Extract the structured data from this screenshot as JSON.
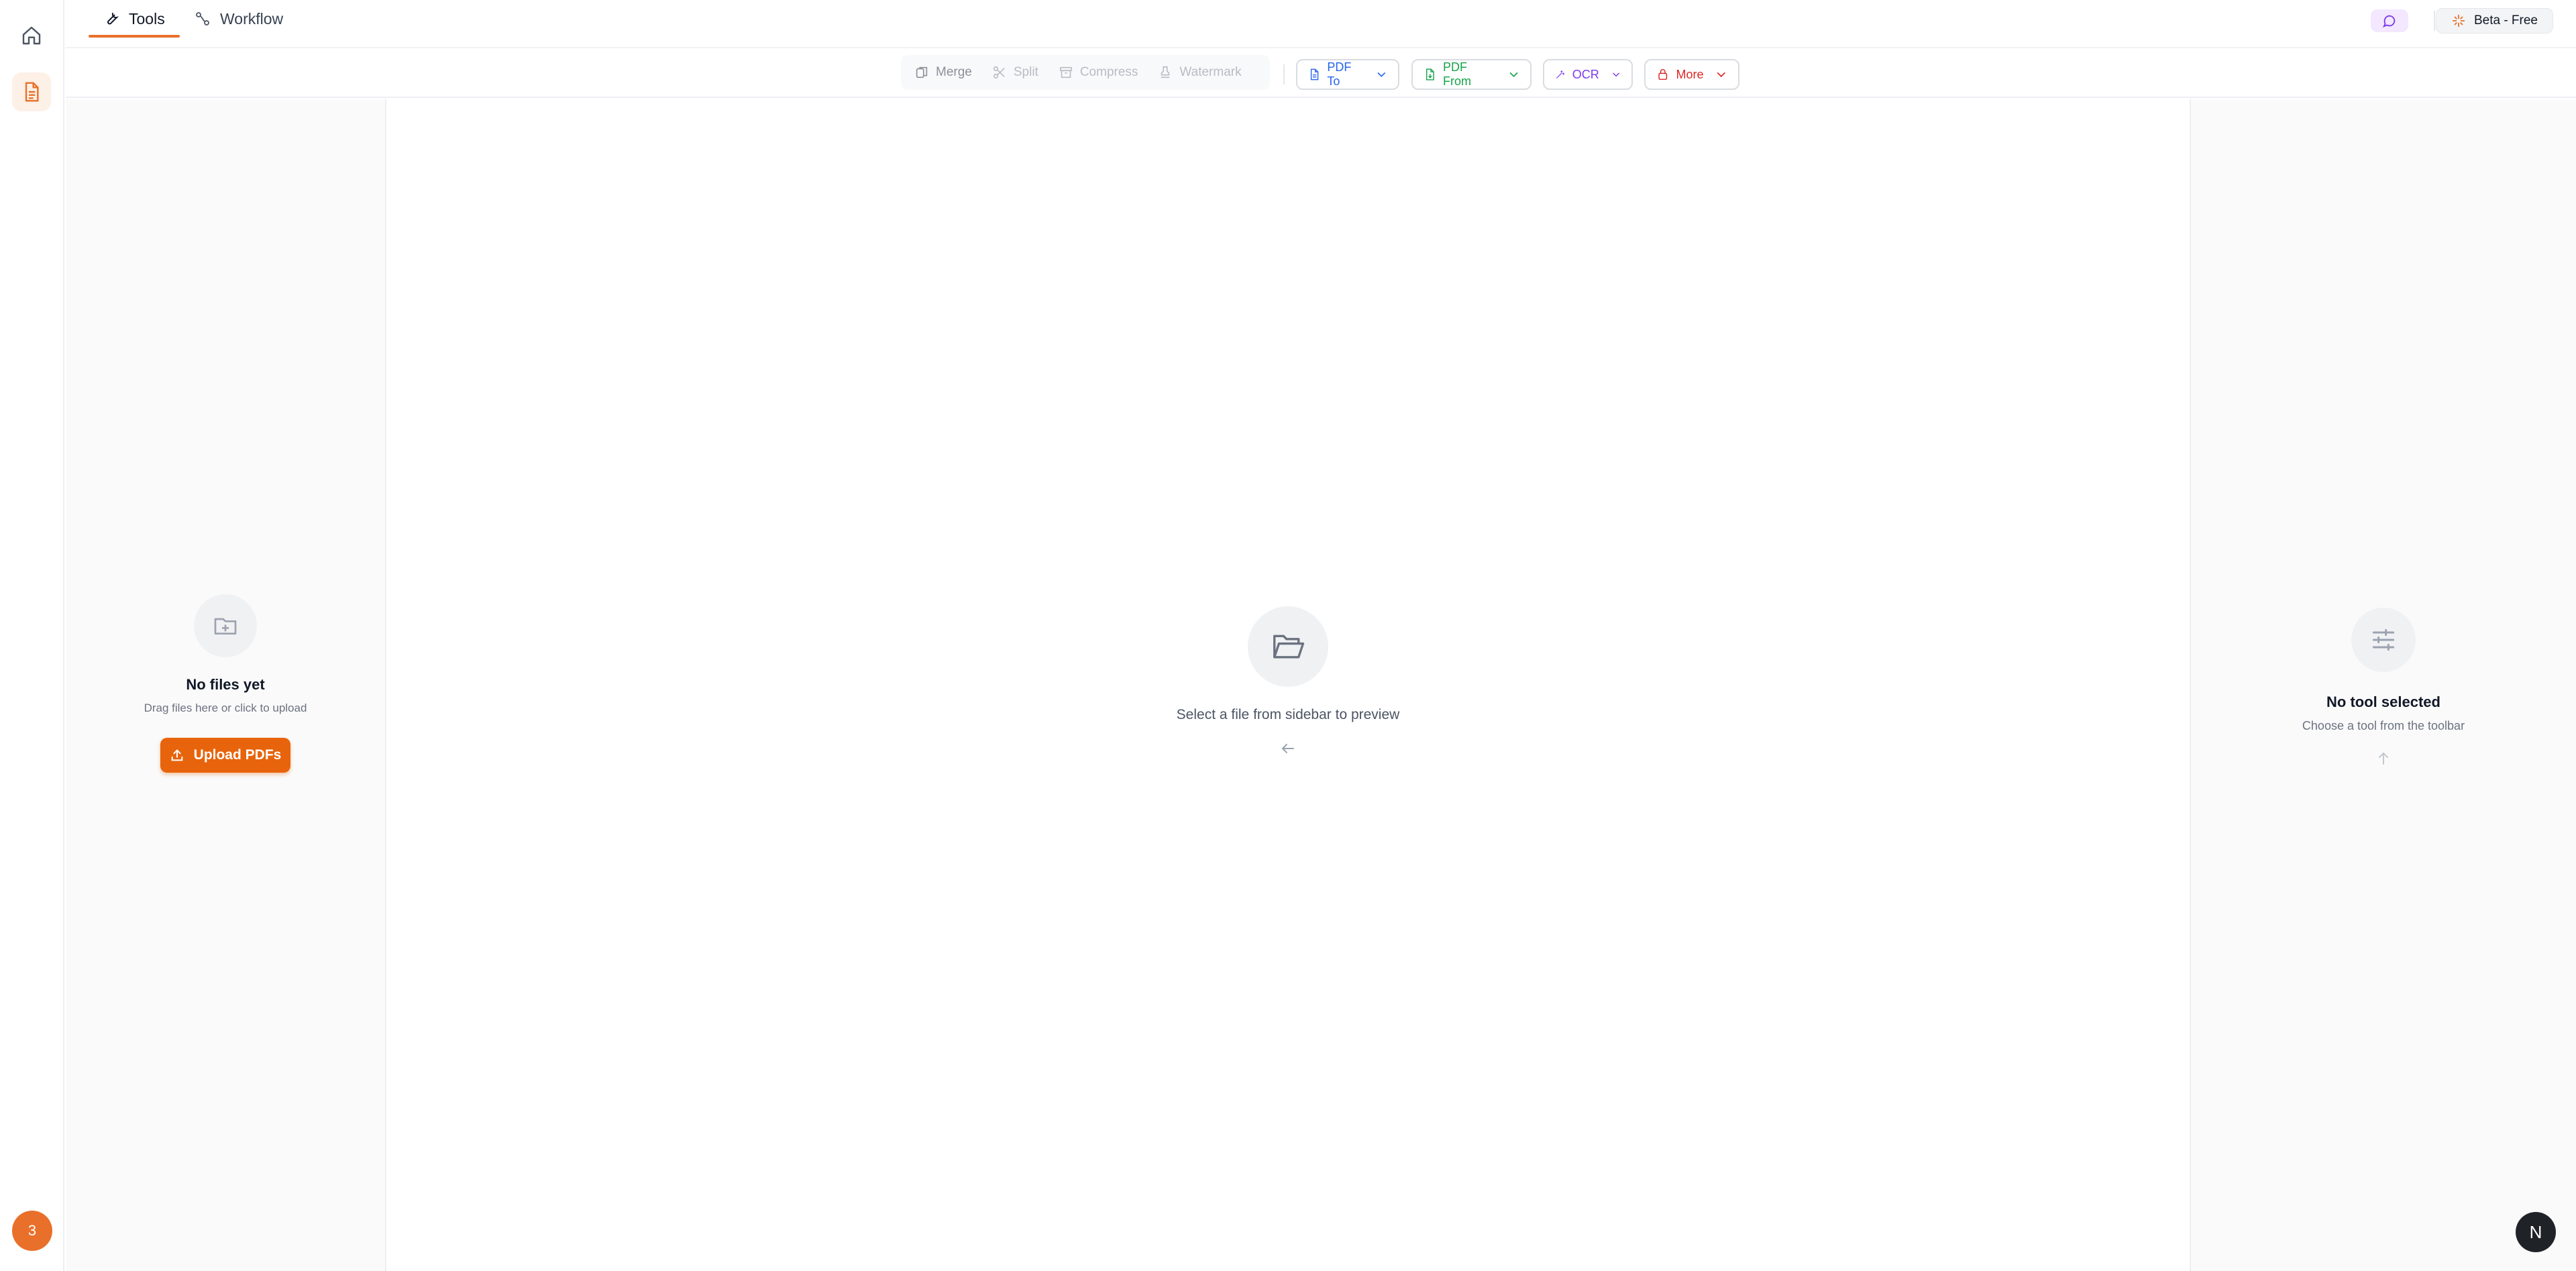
{
  "nav": {
    "tabs": [
      {
        "label": "Tools",
        "icon": "wrench-icon",
        "active": true
      },
      {
        "label": "Workflow",
        "icon": "workflow-icon",
        "active": false
      }
    ],
    "plan_badge": "Beta - Free",
    "accent_color": "#e8702a"
  },
  "rail": {
    "avatar_count": "3"
  },
  "toolbar": {
    "quick_tools": [
      {
        "label": "Merge",
        "icon": "merge-icon"
      },
      {
        "label": "Split",
        "icon": "scissors-icon"
      },
      {
        "label": "Compress",
        "icon": "archive-icon"
      },
      {
        "label": "Watermark",
        "icon": "stamp-icon"
      }
    ],
    "dropdowns": [
      {
        "label": "PDF To",
        "color": "#2563eb"
      },
      {
        "label": "PDF From",
        "color": "#16a34a"
      },
      {
        "label": "OCR",
        "color": "#7c3aed"
      },
      {
        "label": "More",
        "color": "#dc2626"
      }
    ]
  },
  "files_panel": {
    "empty_title": "No files yet",
    "empty_subtitle": "Drag files here or click to upload",
    "upload_label": "Upload PDFs"
  },
  "preview": {
    "empty_text": "Select a file from sidebar to preview"
  },
  "props_panel": {
    "empty_title": "No tool selected",
    "empty_subtitle": "Choose a tool from the toolbar"
  },
  "corner": {
    "label": "N"
  }
}
